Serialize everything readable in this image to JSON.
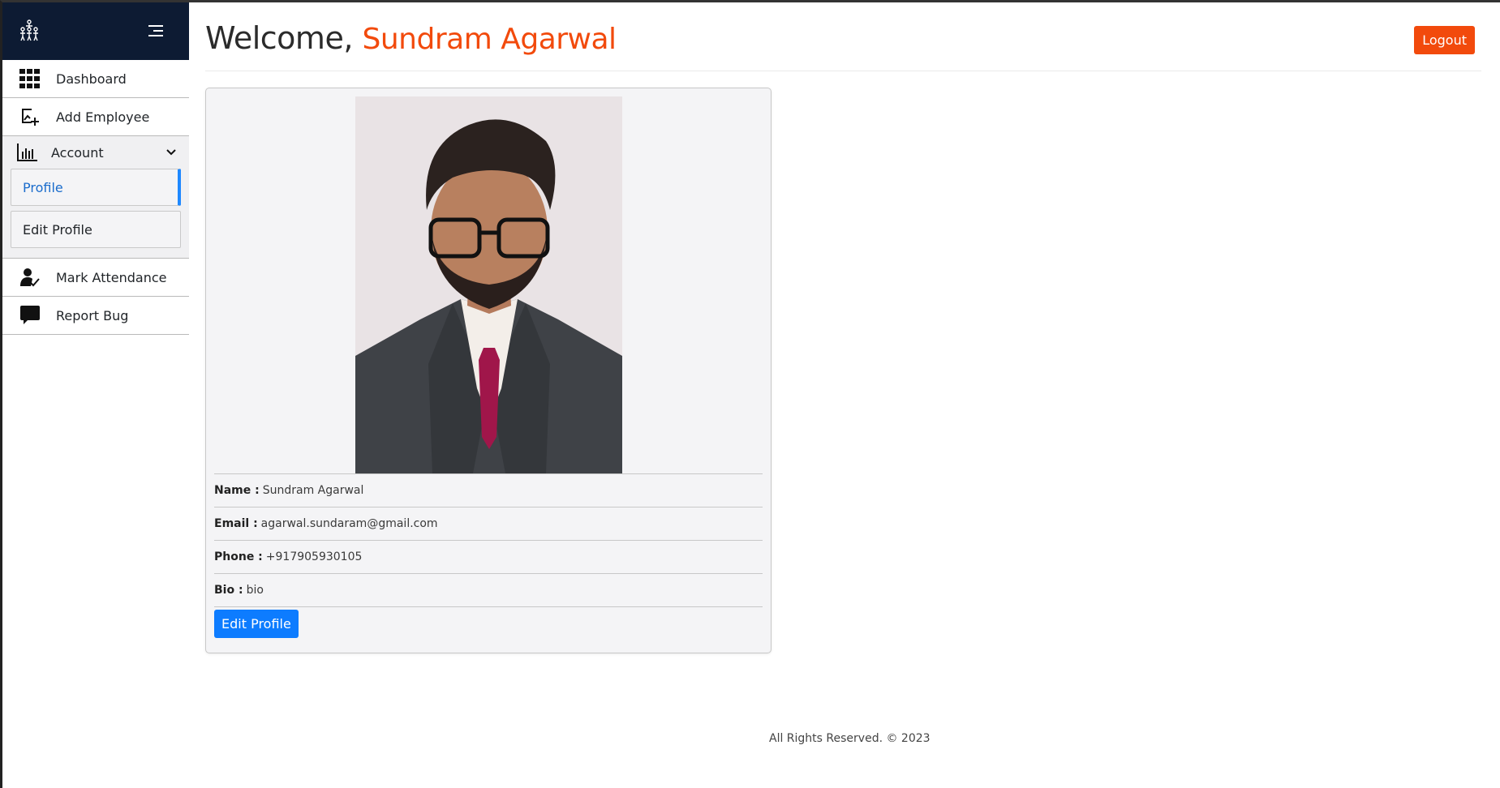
{
  "header": {
    "welcome_prefix": "Welcome,",
    "user_name": "Sundram Agarwal",
    "logout_label": "Logout"
  },
  "sidebar": {
    "items": [
      {
        "label": "Dashboard",
        "icon": "grid-icon"
      },
      {
        "label": "Add Employee",
        "icon": "add-image-icon"
      },
      {
        "label": "Account",
        "icon": "bar-chart-icon"
      },
      {
        "label": "Mark Attendance",
        "icon": "user-check-icon"
      },
      {
        "label": "Report Bug",
        "icon": "chat-icon"
      }
    ],
    "account_submenu": [
      {
        "label": "Profile",
        "active": true
      },
      {
        "label": "Edit Profile",
        "active": false
      }
    ]
  },
  "profile": {
    "fields": [
      {
        "key": "Name :",
        "value": "Sundram Agarwal"
      },
      {
        "key": "Email :",
        "value": "agarwal.sundaram@gmail.com"
      },
      {
        "key": "Phone :",
        "value": "+917905930105"
      },
      {
        "key": "Bio :",
        "value": "bio"
      }
    ],
    "edit_button_label": "Edit Profile"
  },
  "footer": {
    "text": "All Rights Reserved. © 2023"
  },
  "colors": {
    "accent_orange": "#f24a0c",
    "primary_blue": "#0d7cff",
    "sidebar_header": "#0d1b33"
  }
}
